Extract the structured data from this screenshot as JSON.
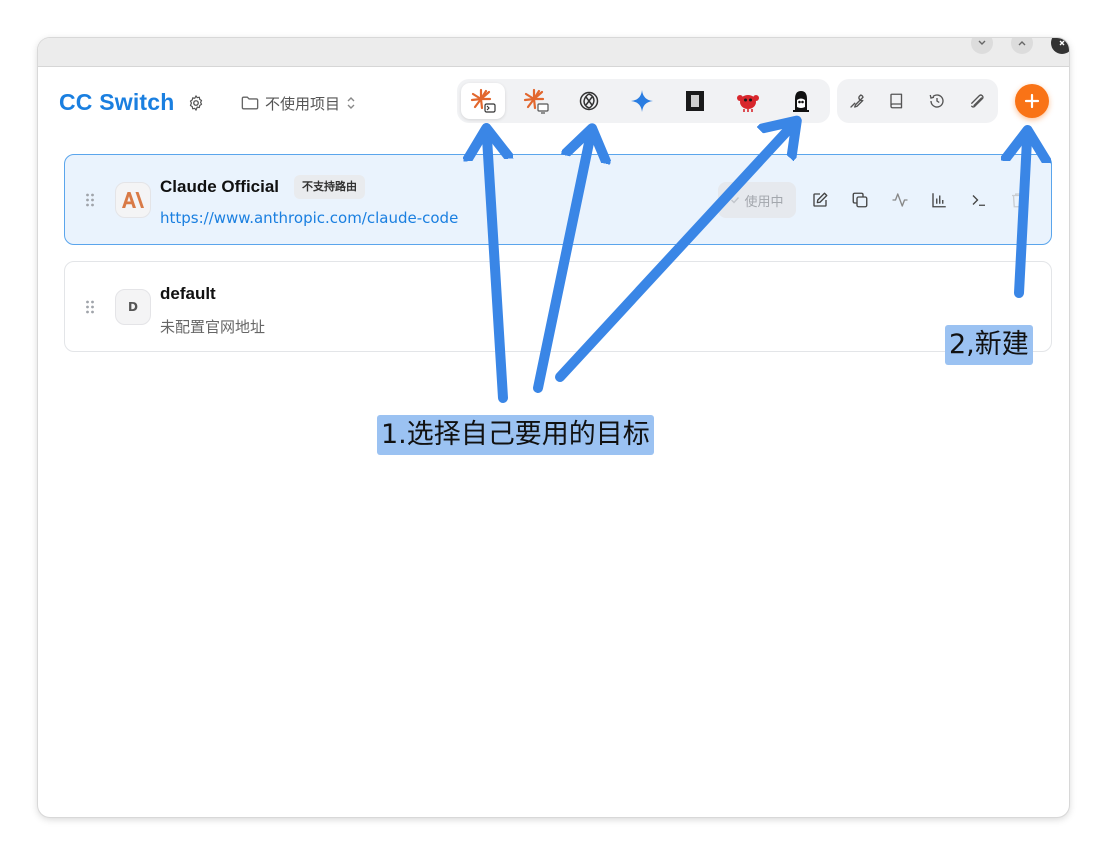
{
  "app": {
    "title": "CC Switch"
  },
  "project": {
    "label": "不使用项目"
  },
  "providers": [
    {
      "name": "Claude Official",
      "badge": "不支持路由",
      "url": "https://www.anthropic.com/claude-code",
      "avatar": "A\\",
      "use_label": "使用中",
      "active": true
    },
    {
      "name": "default",
      "subtitle": "未配置官网地址",
      "avatar": "D",
      "active": false
    }
  ],
  "toolbar": {
    "apps": [
      "claude-code-icon",
      "claude-desktop-icon",
      "openai-codex-icon",
      "gemini-icon",
      "opencode-icon",
      "openclaw-icon",
      "qwen-icon"
    ],
    "tools": [
      "wrench-icon",
      "book-icon",
      "history-icon",
      "paperclip-icon"
    ]
  },
  "annotations": {
    "step1": "1.选择自己要用的目标",
    "step2": "2,新建"
  },
  "colors": {
    "accent": "#1a7fe0",
    "add_button": "#f97316",
    "arrow": "#3a86e6",
    "annotation_bg": "#9bc2f2"
  }
}
